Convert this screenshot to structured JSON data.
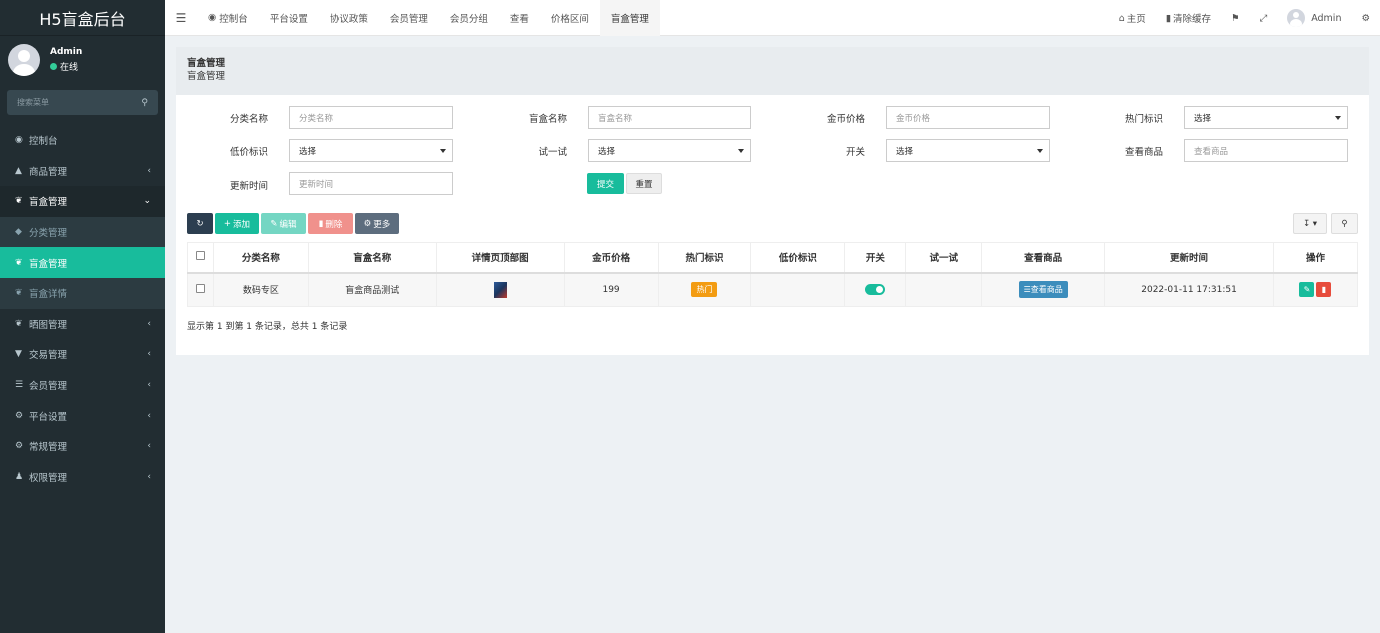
{
  "app": {
    "title": "H5盲盒后台"
  },
  "user": {
    "name": "Admin",
    "status": "在线"
  },
  "sidebar": {
    "search_placeholder": "搜索菜单",
    "items": [
      {
        "label": "控制台",
        "icon": "dashboard-icon"
      },
      {
        "label": "商品管理",
        "icon": "shopping-bag-icon"
      },
      {
        "label": "盲盒管理",
        "icon": "gift-icon"
      },
      {
        "label": "分类管理",
        "icon": "tags-icon"
      },
      {
        "label": "盲盒管理",
        "icon": "gift-icon"
      },
      {
        "label": "盲盒详情",
        "icon": "gift-icon"
      },
      {
        "label": "晒图管理",
        "icon": "gift-icon"
      },
      {
        "label": "交易管理",
        "icon": "cart-icon"
      },
      {
        "label": "会员管理",
        "icon": "list-icon"
      },
      {
        "label": "平台设置",
        "icon": "cogs-icon"
      },
      {
        "label": "常规管理",
        "icon": "cogs-icon"
      },
      {
        "label": "权限管理",
        "icon": "group-icon"
      }
    ]
  },
  "topnav": {
    "tabs": [
      "控制台",
      "平台设置",
      "协议政策",
      "会员管理",
      "会员分组",
      "查看",
      "价格区间",
      "盲盒管理"
    ],
    "right": {
      "home": "主页",
      "clear_cache": "清除缓存",
      "user": "Admin"
    }
  },
  "breadcrumb": {
    "title": "盲盒管理",
    "subtitle": "盲盒管理"
  },
  "filters": {
    "category_label": "分类名称",
    "category_placeholder": "分类名称",
    "box_name_label": "盲盒名称",
    "box_name_placeholder": "盲盒名称",
    "price_label": "金币价格",
    "price_placeholder": "金币价格",
    "hot_label": "热门标识",
    "hot_value": "选择",
    "low_label": "低价标识",
    "low_value": "选择",
    "try_label": "试一试",
    "try_value": "选择",
    "switch_label": "开关",
    "switch_value": "选择",
    "view_label": "查看商品",
    "view_placeholder": "查看商品",
    "updated_label": "更新时间",
    "updated_placeholder": "更新时间",
    "submit": "提交",
    "reset": "重置"
  },
  "toolbar": {
    "add": "添加",
    "edit": "编辑",
    "delete": "删除",
    "more": "更多"
  },
  "table": {
    "headers": [
      "分类名称",
      "盲盒名称",
      "详情页顶部图",
      "金币价格",
      "热门标识",
      "低价标识",
      "开关",
      "试一试",
      "查看商品",
      "更新时间",
      "操作"
    ],
    "rows": [
      {
        "category": "数码专区",
        "name": "盲盒商品测试",
        "price": "199",
        "hot": "热门",
        "view": "查看商品",
        "updated": "2022-01-11 17:31:51"
      }
    ]
  },
  "pagination": {
    "summary": "显示第 1 到第 1 条记录，总共 1 条记录"
  },
  "colors": {
    "accent": "#18bc9c",
    "sidebar": "#222d32",
    "danger": "#e74c3c",
    "warning": "#f39c12",
    "info": "#3c8dbc"
  }
}
